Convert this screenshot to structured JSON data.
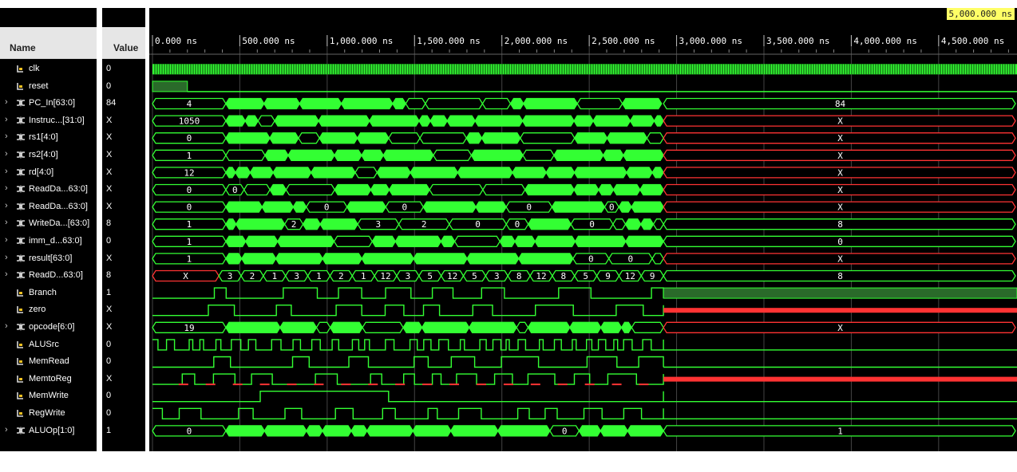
{
  "header": {
    "name_label": "Name",
    "value_label": "Value"
  },
  "cursor_time": "5,000.000 ns",
  "time_axis": {
    "unit": "ns",
    "max_ns": 5000,
    "ticks": [
      "0.000 ns",
      "500.000 ns",
      "1,000.000 ns",
      "1,500.000 ns",
      "2,000.000 ns",
      "2,500.000 ns",
      "3,000.000 ns",
      "3,500.000 ns",
      "4,000.000 ns",
      "4,500.000 ns"
    ],
    "tick_ns": [
      0,
      500,
      1000,
      1500,
      2000,
      2500,
      3000,
      3500,
      4000,
      4500
    ]
  },
  "colors": {
    "wave": "#33ff33",
    "undefined": "#ff3333",
    "background": "#000000",
    "cursor_label_bg": "#ffff66"
  },
  "signals": [
    {
      "name": "clk",
      "value": "0",
      "kind": "bit",
      "expandable": false,
      "pattern": "clock"
    },
    {
      "name": "reset",
      "value": "0",
      "kind": "bit",
      "expandable": false,
      "pattern": "reset"
    },
    {
      "name": "PC_In[63:0]",
      "value": "84",
      "kind": "bus",
      "expandable": true,
      "first": "4",
      "last": "84",
      "last_state": "valid"
    },
    {
      "name": "Instruc...[31:0]",
      "value": "X",
      "kind": "bus",
      "expandable": true,
      "first": "1050",
      "last": "X",
      "last_state": "undefined"
    },
    {
      "name": "rs1[4:0]",
      "value": "X",
      "kind": "bus",
      "expandable": true,
      "first": "0",
      "last": "X",
      "last_state": "undefined"
    },
    {
      "name": "rs2[4:0]",
      "value": "X",
      "kind": "bus",
      "expandable": true,
      "first": "1",
      "last": "X",
      "last_state": "undefined"
    },
    {
      "name": "rd[4:0]",
      "value": "X",
      "kind": "bus",
      "expandable": true,
      "first": "12",
      "last": "X",
      "last_state": "undefined"
    },
    {
      "name": "ReadDa...63:0]",
      "value": "X",
      "kind": "bus",
      "expandable": true,
      "first": "0",
      "last": "X",
      "last_state": "undefined",
      "mid_labels": [
        "0"
      ]
    },
    {
      "name": "ReadDa...63:0]",
      "value": "X",
      "kind": "bus",
      "expandable": true,
      "first": "0",
      "last": "X",
      "last_state": "undefined",
      "mid_labels": [
        "0",
        "0",
        "0",
        "0",
        "0",
        "0"
      ]
    },
    {
      "name": "WriteDa...[63:0]",
      "value": "8",
      "kind": "bus",
      "expandable": true,
      "first": "1",
      "last": "8",
      "last_state": "valid",
      "mid_labels": [
        "2",
        "3",
        "2",
        "0",
        "0",
        "0",
        "0",
        "0"
      ]
    },
    {
      "name": "imm_d...63:0]",
      "value": "0",
      "kind": "bus",
      "expandable": true,
      "first": "1",
      "last": "0",
      "last_state": "valid"
    },
    {
      "name": "result[63:0]",
      "value": "X",
      "kind": "bus",
      "expandable": true,
      "first": "1",
      "last": "X",
      "last_state": "undefined",
      "mid_labels": [
        "0",
        "0",
        "0",
        "0",
        "0"
      ]
    },
    {
      "name": "ReadD...63:0]",
      "value": "8",
      "kind": "bus",
      "expandable": true,
      "first": "X",
      "last": "8",
      "last_state": "valid",
      "sequence": [
        "3",
        "2",
        "1",
        "3",
        "1",
        "2",
        "1",
        "12",
        "3",
        "5",
        "12",
        "5",
        "3",
        "8",
        "12",
        "8",
        "5",
        "9",
        "12",
        "9"
      ]
    },
    {
      "name": "Branch",
      "value": "1",
      "kind": "bit",
      "expandable": false,
      "pattern": "pulses",
      "tail": "high"
    },
    {
      "name": "zero",
      "value": "X",
      "kind": "bit",
      "expandable": false,
      "pattern": "pulses",
      "tail": "undefined"
    },
    {
      "name": "opcode[6:0]",
      "value": "X",
      "kind": "bus",
      "expandable": true,
      "first": "19",
      "last": "X",
      "last_state": "undefined"
    },
    {
      "name": "ALUSrc",
      "value": "0",
      "kind": "bit",
      "expandable": false,
      "pattern": "dense",
      "tail": "low"
    },
    {
      "name": "MemRead",
      "value": "0",
      "kind": "bit",
      "expandable": false,
      "pattern": "sparse",
      "tail": "low"
    },
    {
      "name": "MemtoReg",
      "value": "X",
      "kind": "bit",
      "expandable": false,
      "pattern": "mixed",
      "tail": "undefined"
    },
    {
      "name": "MemWrite",
      "value": "0",
      "kind": "bit",
      "expandable": false,
      "pattern": "rare",
      "tail": "low"
    },
    {
      "name": "RegWrite",
      "value": "0",
      "kind": "bit",
      "expandable": false,
      "pattern": "mostly-high",
      "tail": "low"
    },
    {
      "name": "ALUOp[1:0]",
      "value": "1",
      "kind": "bus",
      "expandable": true,
      "first": "0",
      "last": "1",
      "last_state": "valid",
      "mid_labels": [
        "0",
        "0",
        "0",
        "0",
        "0",
        "0"
      ]
    }
  ]
}
